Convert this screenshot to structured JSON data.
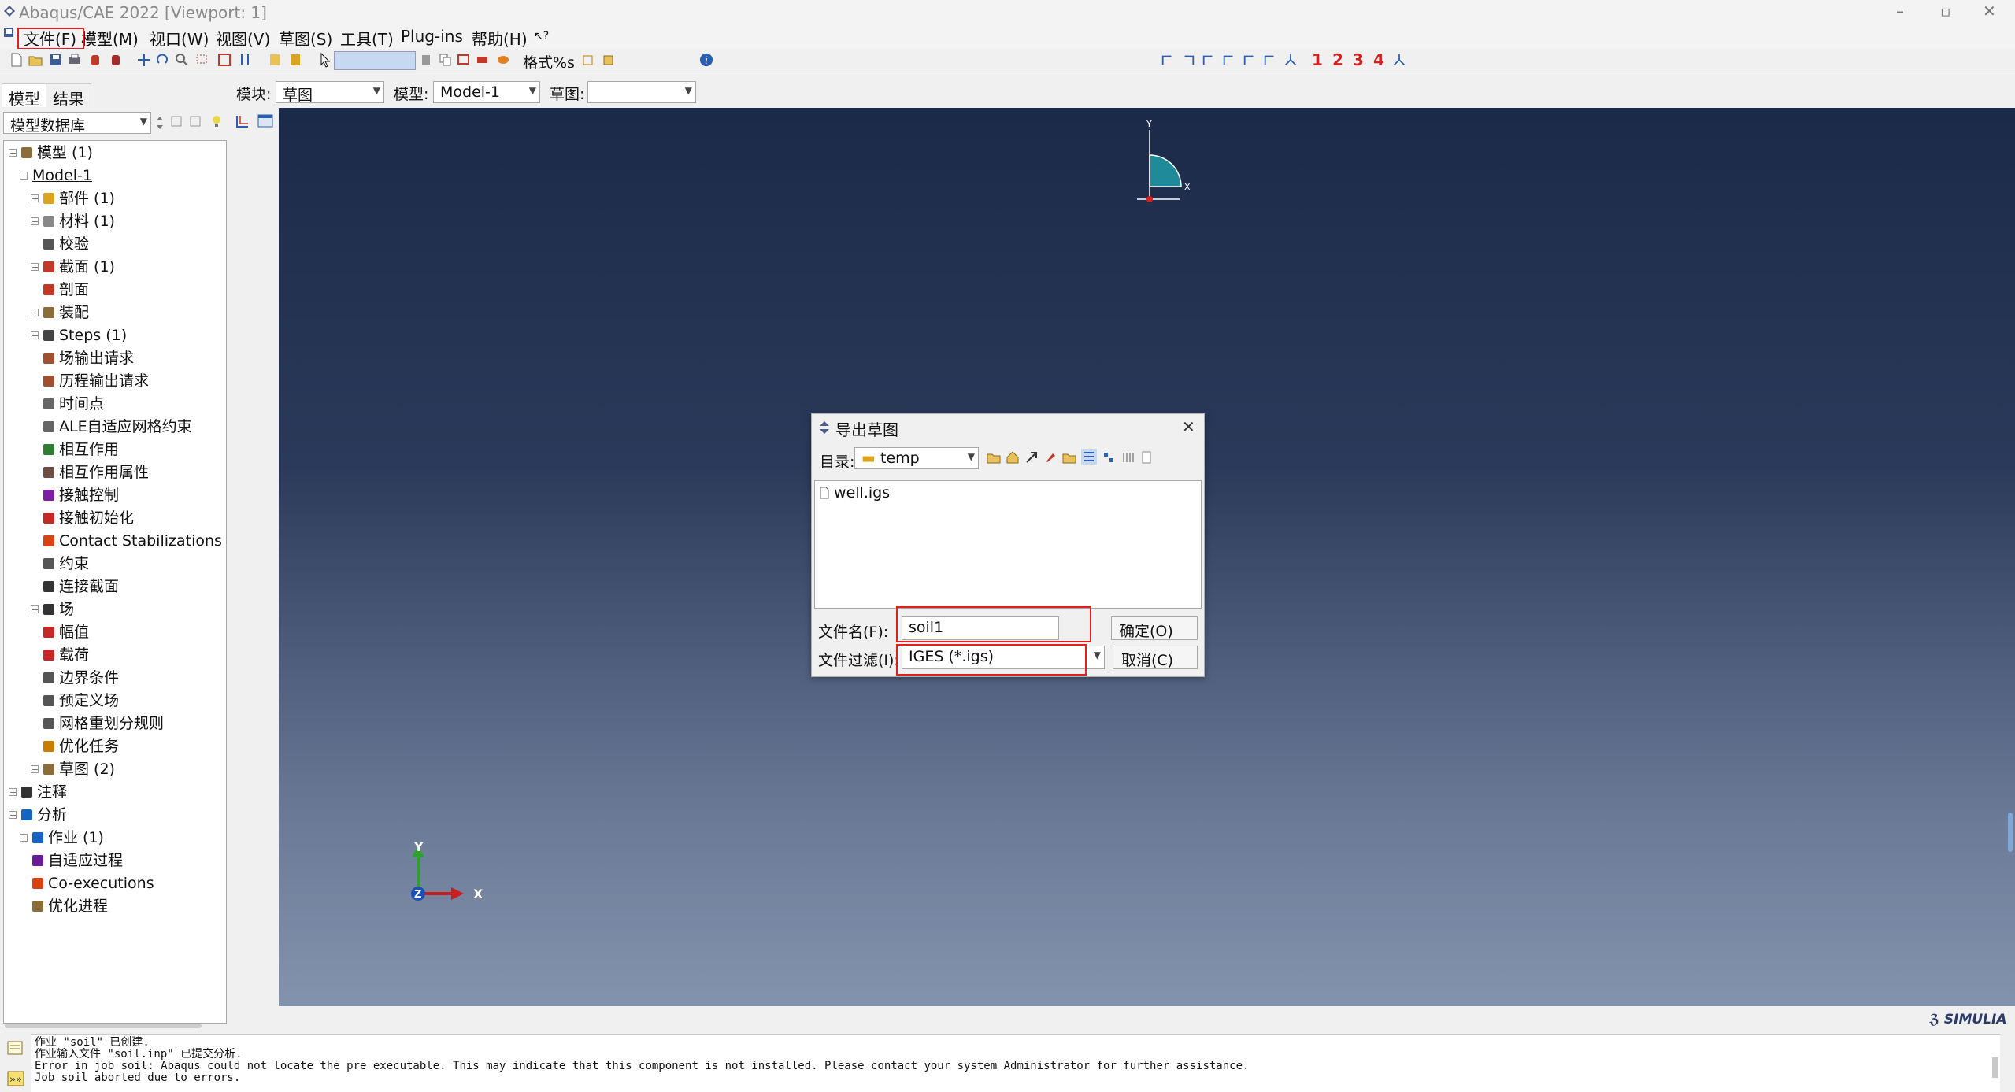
{
  "window": {
    "title": "Abaqus/CAE 2022 [Viewport: 1]",
    "minimize": "–",
    "maximize": "▫",
    "close": "✕"
  },
  "menu": [
    "文件(F)",
    "模型(M)",
    "视口(W)",
    "视图(V)",
    "草图(S)",
    "工具(T)",
    "Plug-ins",
    "帮助(H)"
  ],
  "toolbar": {
    "format_label": "格式%s",
    "view_numbers": [
      "1",
      "2",
      "3",
      "4"
    ]
  },
  "context": {
    "module_label": "模块:",
    "module_value": "草图",
    "model_label": "模型:",
    "model_value": "Model-1",
    "sketch_label": "草图:",
    "sketch_value": ""
  },
  "tabs": [
    "模型",
    "结果"
  ],
  "tree_selector": "模型数据库",
  "tree": [
    {
      "label": "模型 (1)",
      "level": 0,
      "exp": "-",
      "color": "#8a6d3b"
    },
    {
      "label": "Model-1",
      "level": 1,
      "exp": "-",
      "color": "",
      "underline": true
    },
    {
      "label": "部件 (1)",
      "level": 2,
      "exp": "+",
      "color": "#d9a520"
    },
    {
      "label": "材料 (1)",
      "level": 2,
      "exp": "+",
      "color": "#888"
    },
    {
      "label": "校验",
      "level": 2,
      "exp": "",
      "color": "#555"
    },
    {
      "label": "截面 (1)",
      "level": 2,
      "exp": "+",
      "color": "#c0392b"
    },
    {
      "label": "剖面",
      "level": 2,
      "exp": "",
      "color": "#c0392b"
    },
    {
      "label": "装配",
      "level": 2,
      "exp": "+",
      "color": "#8a6d3b"
    },
    {
      "label": "Steps (1)",
      "level": 2,
      "exp": "+",
      "color": "#444"
    },
    {
      "label": "场输出请求",
      "level": 2,
      "exp": "",
      "color": "#a05030"
    },
    {
      "label": "历程输出请求",
      "level": 2,
      "exp": "",
      "color": "#a05030"
    },
    {
      "label": "时间点",
      "level": 2,
      "exp": "",
      "color": "#666"
    },
    {
      "label": "ALE自适应网格约束",
      "level": 2,
      "exp": "",
      "color": "#666"
    },
    {
      "label": "相互作用",
      "level": 2,
      "exp": "",
      "color": "#2e7d32"
    },
    {
      "label": "相互作用属性",
      "level": 2,
      "exp": "",
      "color": "#6d4c41"
    },
    {
      "label": "接触控制",
      "level": 2,
      "exp": "",
      "color": "#7b1fa2"
    },
    {
      "label": "接触初始化",
      "level": 2,
      "exp": "",
      "color": "#c62828"
    },
    {
      "label": "Contact Stabilizations",
      "level": 2,
      "exp": "",
      "color": "#d84315"
    },
    {
      "label": "约束",
      "level": 2,
      "exp": "",
      "color": "#555"
    },
    {
      "label": "连接截面",
      "level": 2,
      "exp": "",
      "color": "#333"
    },
    {
      "label": "场",
      "level": 2,
      "exp": "+",
      "color": "#333"
    },
    {
      "label": "幅值",
      "level": 2,
      "exp": "",
      "color": "#c62828"
    },
    {
      "label": "载荷",
      "level": 2,
      "exp": "",
      "color": "#c62828"
    },
    {
      "label": "边界条件",
      "level": 2,
      "exp": "",
      "color": "#555"
    },
    {
      "label": "预定义场",
      "level": 2,
      "exp": "",
      "color": "#555"
    },
    {
      "label": "网格重划分规则",
      "level": 2,
      "exp": "",
      "color": "#555"
    },
    {
      "label": "优化任务",
      "level": 2,
      "exp": "",
      "color": "#c77c02"
    },
    {
      "label": "草图 (2)",
      "level": 2,
      "exp": "+",
      "color": "#8a6d3b"
    },
    {
      "label": "注释",
      "level": 0,
      "exp": "+",
      "color": "#333"
    },
    {
      "label": "分析",
      "level": 0,
      "exp": "-",
      "color": "#1565c0"
    },
    {
      "label": "作业 (1)",
      "level": 1,
      "exp": "+",
      "color": "#1565c0"
    },
    {
      "label": "自适应过程",
      "level": 1,
      "exp": "",
      "color": "#6a1b9a"
    },
    {
      "label": "Co-executions",
      "level": 1,
      "exp": "",
      "color": "#d84315"
    },
    {
      "label": "优化进程",
      "level": 1,
      "exp": "",
      "color": "#8a6d3b"
    }
  ],
  "triad": {
    "x": "X",
    "y": "Y",
    "z": "Z"
  },
  "mini_triad": {
    "x": "X",
    "y": "Y"
  },
  "brand": "SIMULIA",
  "messages": [
    "作业 \"soil\" 已创建.",
    "作业输入文件 \"soil.inp\" 已提交分析.",
    "Error in job soil: Abaqus could not locate the pre executable. This may indicate that this component is not installed. Please contact your system Administrator for further assistance.",
    "Job soil aborted due to errors."
  ],
  "dialog": {
    "title": "导出草图",
    "dir_label": "目录:",
    "dir_value": "temp",
    "files": [
      "well.igs"
    ],
    "filename_label": "文件名(F):",
    "filename_value": "soil1",
    "filter_label": "文件过滤(I):",
    "filter_value": "IGES (*.igs)",
    "ok": "确定(O)",
    "cancel": "取消(C)"
  },
  "colors": {
    "highlight": "#e02020",
    "viewport_top": "#1b2a48",
    "viewport_bottom": "#8393ad"
  }
}
